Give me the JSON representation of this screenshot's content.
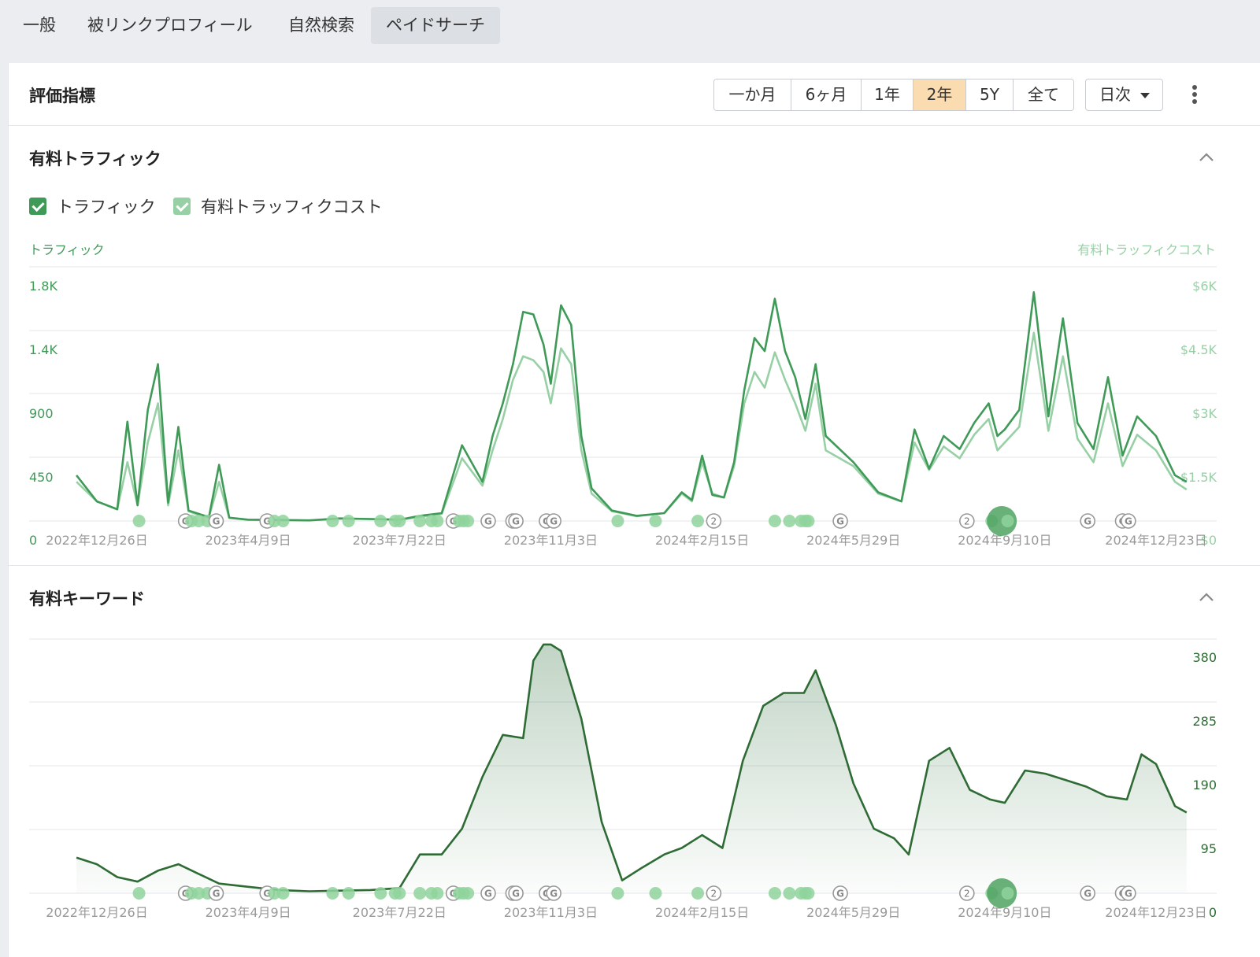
{
  "tabs": [
    {
      "label": "一般",
      "active": false
    },
    {
      "label": "被リンクプロフィール",
      "active": false
    },
    {
      "label": "自然検索",
      "active": false
    },
    {
      "label": "ペイドサーチ",
      "active": true
    }
  ],
  "header": {
    "title": "評価指標",
    "ranges": [
      {
        "label": "一か月",
        "active": false
      },
      {
        "label": "6ヶ月",
        "active": false
      },
      {
        "label": "1年",
        "active": false
      },
      {
        "label": "2年",
        "active": true
      },
      {
        "label": "5Y",
        "active": false
      },
      {
        "label": "全て",
        "active": false
      }
    ],
    "interval": "日次"
  },
  "colors": {
    "traffic": "#3f9a58",
    "cost": "#98d0a6",
    "keywords_line": "#2e6b35",
    "range_active": "#fbdcb0"
  },
  "traffic_section": {
    "title": "有料トラフィック",
    "legend": [
      {
        "label": "トラフィック",
        "checked": true,
        "color": "#3f9a58"
      },
      {
        "label": "有料トラッフィクコスト",
        "checked": true,
        "color": "#98d0a6"
      }
    ],
    "left_axis_name": "トラフィック",
    "right_axis_name": "有料トラッフィクコスト"
  },
  "keywords_section": {
    "title": "有料キーワード"
  },
  "chart_data": [
    {
      "type": "line",
      "x": [
        "2022-12-12",
        "2022-12-26",
        "2023-01-09",
        "2023-01-16",
        "2023-01-23",
        "2023-01-30",
        "2023-02-06",
        "2023-02-13",
        "2023-02-20",
        "2023-02-27",
        "2023-03-06",
        "2023-03-13",
        "2023-03-20",
        "2023-03-27",
        "2023-04-09",
        "2023-04-30",
        "2023-05-21",
        "2023-06-11",
        "2023-07-02",
        "2023-07-22",
        "2023-08-05",
        "2023-08-20",
        "2023-09-03",
        "2023-09-17",
        "2023-09-24",
        "2023-10-01",
        "2023-10-08",
        "2023-10-15",
        "2023-10-22",
        "2023-10-29",
        "2023-11-03",
        "2023-11-10",
        "2023-11-17",
        "2023-11-24",
        "2023-12-01",
        "2023-12-15",
        "2024-01-01",
        "2024-01-20",
        "2024-02-01",
        "2024-02-08",
        "2024-02-15",
        "2024-02-22",
        "2024-03-01",
        "2024-03-08",
        "2024-03-15",
        "2024-03-22",
        "2024-03-29",
        "2024-04-05",
        "2024-04-12",
        "2024-04-19",
        "2024-04-26",
        "2024-05-03",
        "2024-05-10",
        "2024-05-29",
        "2024-06-15",
        "2024-07-01",
        "2024-07-10",
        "2024-07-20",
        "2024-07-30",
        "2024-08-10",
        "2024-08-20",
        "2024-08-30",
        "2024-09-05",
        "2024-09-10",
        "2024-09-20",
        "2024-09-30",
        "2024-10-10",
        "2024-10-20",
        "2024-10-30",
        "2024-11-10",
        "2024-11-20",
        "2024-11-30",
        "2024-12-10",
        "2024-12-23",
        "2025-01-05",
        "2025-01-13"
      ],
      "series": [
        {
          "name": "トラフィック",
          "values": [
            350,
            150,
            90,
            760,
            120,
            850,
            1200,
            140,
            720,
            80,
            55,
            30,
            430,
            25,
            10,
            8,
            5,
            20,
            15,
            10,
            40,
            60,
            580,
            300,
            650,
            900,
            1200,
            1600,
            1580,
            1350,
            1050,
            1650,
            1500,
            650,
            250,
            80,
            40,
            60,
            220,
            160,
            500,
            200,
            180,
            450,
            1000,
            1400,
            1300,
            1700,
            1300,
            1100,
            780,
            1200,
            650,
            450,
            220,
            150,
            700,
            400,
            650,
            550,
            750,
            900,
            650,
            700,
            850,
            1750,
            800,
            1550,
            750,
            550,
            1100,
            500,
            800,
            650,
            350,
            300
          ],
          "axis": "left"
        },
        {
          "name": "有料トラッフィクコスト",
          "values": [
            1000,
            500,
            300,
            1500,
            400,
            2000,
            3000,
            400,
            1800,
            250,
            150,
            100,
            1000,
            80,
            30,
            25,
            15,
            60,
            50,
            30,
            100,
            180,
            1600,
            900,
            1800,
            2600,
            3600,
            4200,
            4100,
            3800,
            3000,
            4400,
            4000,
            1800,
            700,
            250,
            120,
            200,
            700,
            500,
            1500,
            700,
            600,
            1400,
            3000,
            3800,
            3400,
            4300,
            3600,
            3000,
            2300,
            3500,
            1800,
            1400,
            700,
            500,
            2000,
            1300,
            1900,
            1600,
            2200,
            2600,
            1800,
            2000,
            2400,
            4800,
            2300,
            4200,
            2100,
            1500,
            3000,
            1400,
            2200,
            1800,
            1000,
            800
          ],
          "axis": "right"
        }
      ],
      "left_ticks": [
        "0",
        "450",
        "900",
        "1.4K",
        "1.8K"
      ],
      "right_ticks": [
        "$0",
        "$1.5K",
        "$3K",
        "$4.5K",
        "$6K"
      ],
      "x_ticks": [
        "2022年12月26日",
        "2023年4月9日",
        "2023年7月22日",
        "2023年11月3日",
        "2024年2月15日",
        "2024年5月29日",
        "2024年9月10日",
        "2024年12月23日"
      ],
      "ylim_left": [
        0,
        1800
      ],
      "ylim_right": [
        0,
        6000
      ],
      "grid": true
    },
    {
      "type": "area",
      "x": [
        "2022-12-12",
        "2022-12-26",
        "2023-01-09",
        "2023-01-23",
        "2023-02-06",
        "2023-02-20",
        "2023-03-06",
        "2023-03-20",
        "2023-04-09",
        "2023-04-30",
        "2023-05-21",
        "2023-06-11",
        "2023-07-02",
        "2023-07-22",
        "2023-08-05",
        "2023-08-20",
        "2023-09-03",
        "2023-09-17",
        "2023-10-01",
        "2023-10-15",
        "2023-10-22",
        "2023-10-29",
        "2023-11-03",
        "2023-11-10",
        "2023-11-24",
        "2023-12-08",
        "2023-12-22",
        "2024-01-05",
        "2024-01-20",
        "2024-02-01",
        "2024-02-15",
        "2024-02-29",
        "2024-03-14",
        "2024-03-28",
        "2024-04-11",
        "2024-04-25",
        "2024-05-03",
        "2024-05-17",
        "2024-05-29",
        "2024-06-12",
        "2024-06-26",
        "2024-07-06",
        "2024-07-20",
        "2024-08-03",
        "2024-08-17",
        "2024-08-31",
        "2024-09-10",
        "2024-09-24",
        "2024-10-08",
        "2024-10-22",
        "2024-11-05",
        "2024-11-19",
        "2024-12-03",
        "2024-12-13",
        "2024-12-23",
        "2025-01-05",
        "2025-01-13"
      ],
      "series": [
        {
          "name": "",
          "values": [
            55,
            45,
            25,
            18,
            35,
            45,
            30,
            15,
            10,
            5,
            3,
            4,
            5,
            8,
            60,
            60,
            100,
            180,
            245,
            240,
            360,
            385,
            385,
            375,
            270,
            110,
            20,
            40,
            60,
            70,
            90,
            70,
            205,
            290,
            310,
            310,
            345,
            260,
            170,
            100,
            85,
            60,
            205,
            225,
            160,
            145,
            140,
            190,
            185,
            175,
            165,
            150,
            145,
            215,
            200,
            135,
            125
          ]
        }
      ],
      "right_ticks": [
        "95",
        "190",
        "285",
        "380"
      ],
      "x_ticks": [
        "2022年12月26日",
        "2023年4月9日",
        "2023年7月22日",
        "2023年11月3日",
        "2024年2月15日",
        "2024年5月29日",
        "2024年9月10日",
        "2024年12月23日"
      ],
      "zero_label": "0",
      "ylim": [
        0,
        380
      ],
      "grid": true
    }
  ],
  "event_markers": [
    {
      "kind": "dot",
      "date": "2023-01-24"
    },
    {
      "kind": "google",
      "date": "2023-02-25"
    },
    {
      "kind": "dot",
      "date": "2023-03-01"
    },
    {
      "kind": "dot",
      "date": "2023-03-06"
    },
    {
      "kind": "dot",
      "date": "2023-03-12"
    },
    {
      "kind": "google",
      "date": "2023-03-18"
    },
    {
      "kind": "google",
      "date": "2023-04-22"
    },
    {
      "kind": "dot",
      "date": "2023-04-27"
    },
    {
      "kind": "dot",
      "date": "2023-05-03"
    },
    {
      "kind": "dot",
      "date": "2023-06-06"
    },
    {
      "kind": "dot",
      "date": "2023-06-17"
    },
    {
      "kind": "dot",
      "date": "2023-07-09"
    },
    {
      "kind": "dot",
      "date": "2023-07-19"
    },
    {
      "kind": "dot",
      "date": "2023-07-22"
    },
    {
      "kind": "dot",
      "date": "2023-08-05"
    },
    {
      "kind": "dot",
      "date": "2023-08-13"
    },
    {
      "kind": "dot",
      "date": "2023-08-17"
    },
    {
      "kind": "google",
      "date": "2023-08-28"
    },
    {
      "kind": "dot",
      "date": "2023-09-01"
    },
    {
      "kind": "dot",
      "date": "2023-09-04"
    },
    {
      "kind": "dot",
      "date": "2023-09-07"
    },
    {
      "kind": "google",
      "date": "2023-09-21"
    },
    {
      "kind": "google",
      "date": "2023-10-08"
    },
    {
      "kind": "google",
      "date": "2023-10-10"
    },
    {
      "kind": "google",
      "date": "2023-10-31"
    },
    {
      "kind": "google",
      "date": "2023-11-05"
    },
    {
      "kind": "dot",
      "date": "2023-12-19"
    },
    {
      "kind": "dot",
      "date": "2024-01-14"
    },
    {
      "kind": "dot",
      "date": "2024-02-12"
    },
    {
      "kind": "number",
      "date": "2024-02-23",
      "label": "2"
    },
    {
      "kind": "dot",
      "date": "2024-04-05"
    },
    {
      "kind": "dot",
      "date": "2024-04-15"
    },
    {
      "kind": "dot",
      "date": "2024-04-23"
    },
    {
      "kind": "dot",
      "date": "2024-04-26"
    },
    {
      "kind": "dot",
      "date": "2024-04-28"
    },
    {
      "kind": "google",
      "date": "2024-05-20"
    },
    {
      "kind": "number",
      "date": "2024-08-15",
      "label": "2"
    },
    {
      "kind": "dot",
      "date": "2024-09-01"
    },
    {
      "kind": "big",
      "date": "2024-09-08"
    },
    {
      "kind": "dot",
      "date": "2024-09-12"
    },
    {
      "kind": "google",
      "date": "2024-11-06"
    },
    {
      "kind": "google",
      "date": "2024-11-30"
    },
    {
      "kind": "google",
      "date": "2024-12-04"
    }
  ]
}
